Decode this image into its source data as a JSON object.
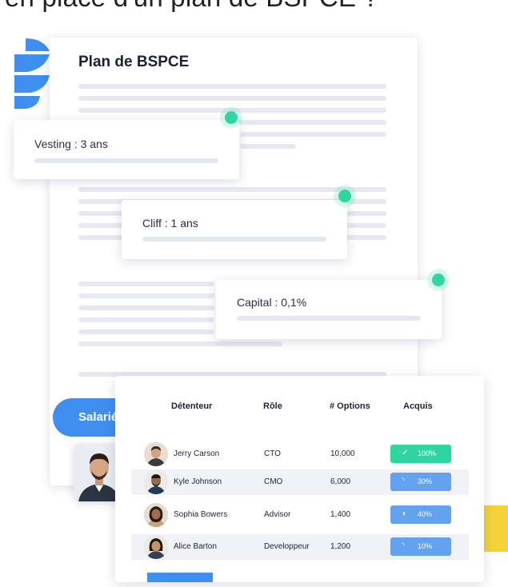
{
  "heading": "en place d'un plan de BSPCE ?",
  "document": {
    "title": "Plan de BSPCE"
  },
  "cards": {
    "vesting": "Vesting : 3 ans",
    "cliff": "Cliff : 1 ans",
    "capital": "Capital : 0,1%"
  },
  "employee_button": "Salarié",
  "table": {
    "headers": {
      "holder": "Détenteur",
      "role": "Rôle",
      "options": "# Options",
      "vested": "Acquis"
    },
    "rows": [
      {
        "name": "Jerry Carson",
        "role": "CTO",
        "options": "10,000",
        "vested": "100%",
        "status_icon": "check-icon"
      },
      {
        "name": "Kyle Johnson",
        "role": "CMO",
        "options": "6,000",
        "vested": "30%",
        "status_icon": "progress-icon"
      },
      {
        "name": "Sophia Bowers",
        "role": "Advisor",
        "options": "1,400",
        "vested": "40%",
        "status_icon": "progress-icon"
      },
      {
        "name": "Alice Barton",
        "role": "Developpeur",
        "options": "1,200",
        "vested": "10%",
        "status_icon": "progress-icon"
      }
    ]
  },
  "colors": {
    "accent_green": "#2fd6a0",
    "accent_blue": "#3f8ff0",
    "badge_green": "#2fd6a0",
    "badge_blue": "#63a2ee",
    "purple": "#7b83f2",
    "yellow": "#f5d338"
  }
}
